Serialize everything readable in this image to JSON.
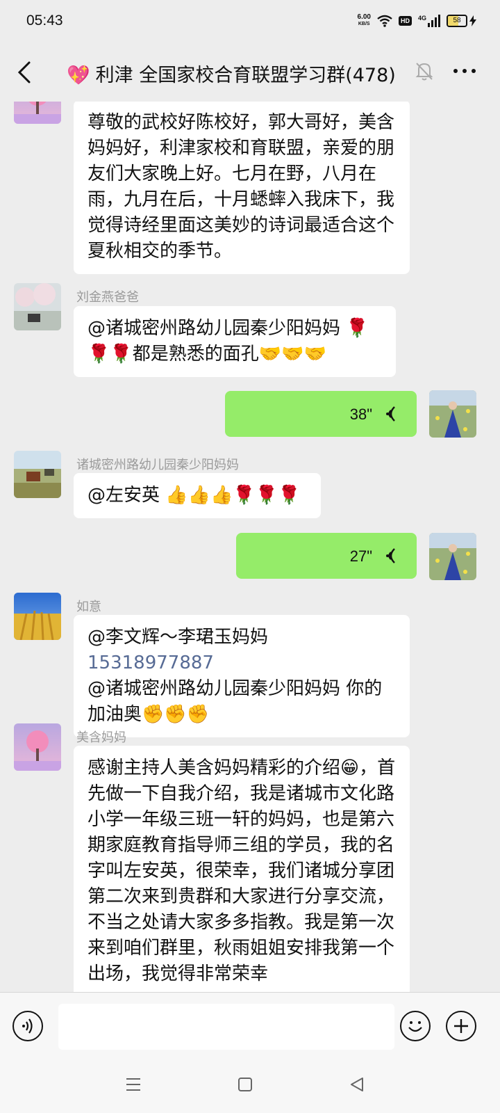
{
  "status": {
    "time": "05:43",
    "net_speed": "6.00",
    "net_unit": "KB/S",
    "hd": "HD",
    "signal": "4G",
    "battery": "58"
  },
  "header": {
    "title_emoji": "💖",
    "title": "利津 全国家校合育联盟学习群(478)"
  },
  "messages": [
    {
      "sender": "",
      "text": "尊敬的武校好陈校好，郭大哥好，美含妈妈好，利津家校和育联盟，亲爱的朋友们大家晚上好。七月在野，八月在雨，九月在后，十月蟋蟀入我床下，我觉得诗经里面这美妙的诗词最适合这个夏秋相交的季节。"
    },
    {
      "sender": "刘金燕爸爸",
      "text": "@诸城密州路幼儿园秦少阳妈妈 🌹🌹🌹都是熟悉的面孔🤝🤝🤝"
    },
    {
      "duration": "38\""
    },
    {
      "sender": "诸城密州路幼儿园秦少阳妈妈",
      "text": "@左安英 👍👍👍🌹🌹🌹"
    },
    {
      "duration": "27\""
    },
    {
      "sender": "如意",
      "text_a": "@李文辉～李珺玉妈妈 ",
      "phone": "15318977887",
      "text_b": "@诸城密州路幼儿园秦少阳妈妈  你的加油奥✊✊✊"
    },
    {
      "sender": "美含妈妈",
      "text": "感谢主持人美含妈妈精彩的介绍😁，首先做一下自我介绍，我是诸城市文化路小学一年级三班一轩的妈妈，也是第六期家庭教育指导师三组的学员，我的名字叫左安英，很荣幸，我们诸城分享团第二次来到贵群和大家进行分享交流，不当之处请大家多多指教。我是第一次来到咱们群里，秋雨姐姐安排我第一个出场，我觉得非常荣幸"
    }
  ],
  "input": {
    "placeholder": ""
  },
  "colors": {
    "self_bubble": "#95ec69",
    "other_bubble": "#ffffff",
    "background": "#ededed",
    "phone_link": "#576b95"
  }
}
